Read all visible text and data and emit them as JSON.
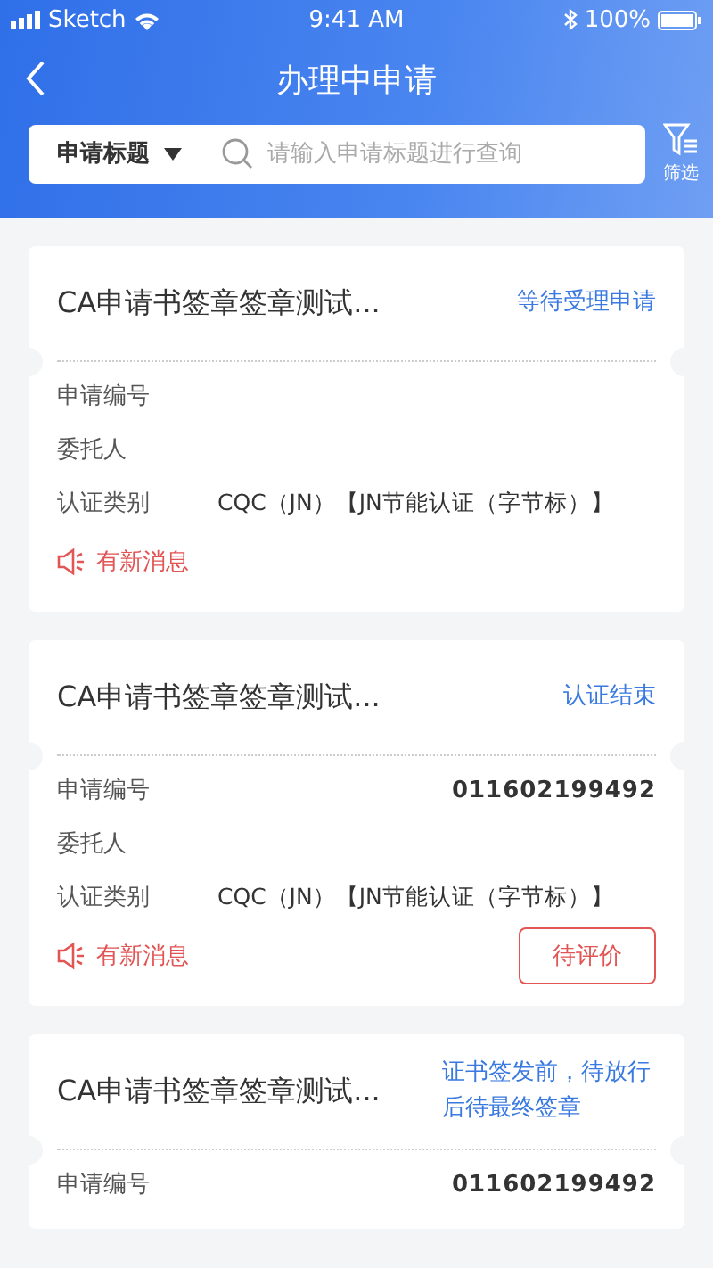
{
  "status_bar": {
    "carrier": "Sketch",
    "time": "9:41 AM",
    "battery": "100%"
  },
  "header": {
    "title": "办理中申请"
  },
  "search": {
    "dropdown": "申请标题",
    "placeholder": "请输入申请标题进行查询",
    "filter_label": "筛选"
  },
  "cards": [
    {
      "title": "CA申请书签章签章测试...",
      "status": "等待受理申请",
      "fields": [
        {
          "label": "申请编号",
          "kind": "number"
        },
        {
          "label": "委托人",
          "kind": "text"
        },
        {
          "label": "认证类别",
          "kind": "text",
          "value": "CQC（JN）【JN节能认证（字节标）】"
        }
      ],
      "message": "有新消息"
    },
    {
      "title": "CA申请书签章签章测试...",
      "status": "认证结束",
      "fields": [
        {
          "label": "申请编号",
          "kind": "number",
          "value": "011602199492"
        },
        {
          "label": "委托人",
          "kind": "text"
        },
        {
          "label": "认证类别",
          "kind": "text",
          "value": "CQC（JN）【JN节能认证（字节标）】"
        }
      ],
      "message": "有新消息",
      "action": "待评价"
    },
    {
      "title": "CA申请书签章签章测试...",
      "status": "证书签发前，待放行后待最终签章",
      "fields": [
        {
          "label": "申请编号",
          "kind": "number",
          "value": "011602199492"
        }
      ]
    }
  ]
}
